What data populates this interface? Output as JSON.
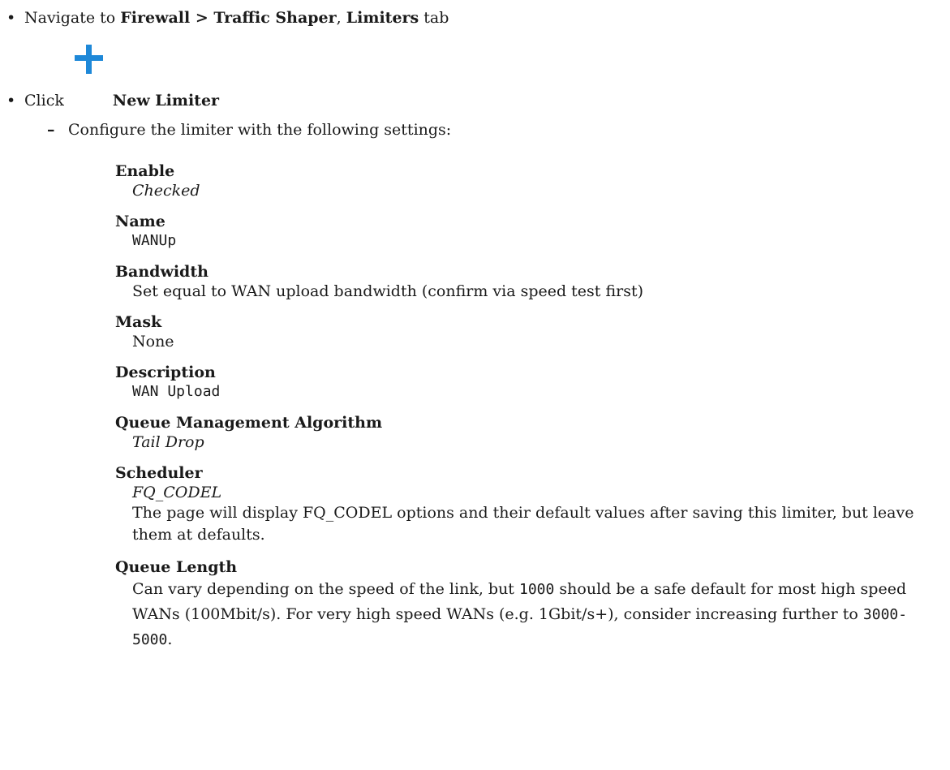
{
  "steps": {
    "navigate": {
      "prefix": "Navigate to",
      "path": "Firewall > Traffic Shaper",
      "separator": ",",
      "tab_name": "Limiters",
      "suffix": "tab"
    },
    "click": {
      "prefix": "Click",
      "icon": "plus-icon",
      "icon_color": "#1e88d8",
      "button_label": "New Limiter"
    },
    "configure_intro": "Configure the limiter with the following settings:"
  },
  "settings": [
    {
      "term": "Enable",
      "value": "Checked",
      "style": "italic"
    },
    {
      "term": "Name",
      "value": "WANUp",
      "style": "mono"
    },
    {
      "term": "Bandwidth",
      "value": "Set equal to WAN upload bandwidth (confirm via speed test first)",
      "style": "plain"
    },
    {
      "term": "Mask",
      "value": "None",
      "style": "plain"
    },
    {
      "term": "Description",
      "value": "WAN Upload",
      "style": "mono"
    },
    {
      "term": "Queue Management Algorithm",
      "value": "Tail Drop",
      "style": "italic"
    },
    {
      "term": "Scheduler",
      "value": "FQ_CODEL",
      "style": "italic",
      "note": "The page will display FQ_CODEL options and their default values after saving this limiter, but leave them at defaults."
    },
    {
      "term": "Queue Length",
      "parts": {
        "a": "Can vary depending on the speed of the link, but",
        "b": "1000",
        "c": "should be a safe default for most high speed WANs (100Mbit/s). For very high speed WANs (e.g. 1Gbit/s+), consider increasing further to",
        "d": "3000",
        "e": "-",
        "f": "5000",
        "g": "."
      }
    }
  ]
}
